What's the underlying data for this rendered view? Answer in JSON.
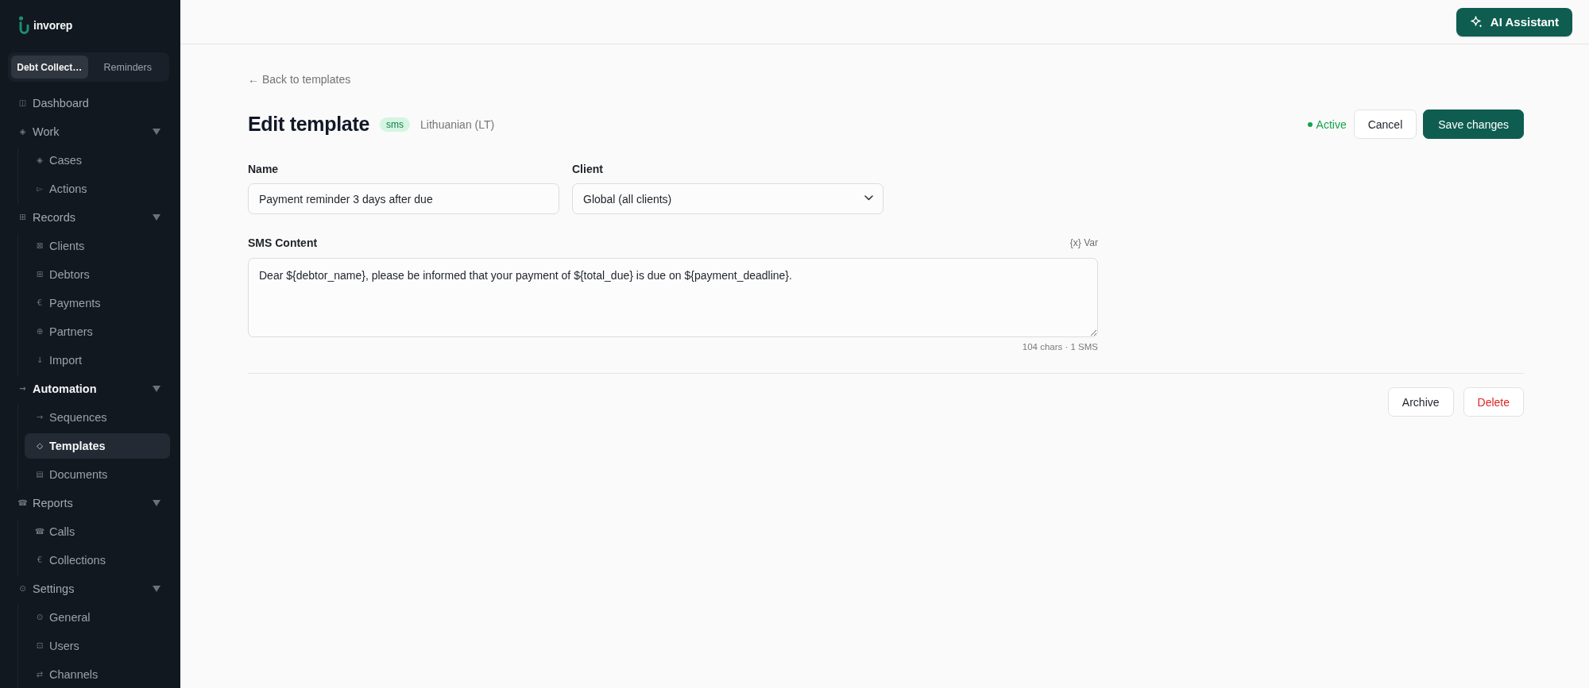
{
  "sidebar": {
    "logo": "invorep",
    "modes": [
      {
        "label": "Debt Collect…",
        "selected": true
      },
      {
        "label": "Reminders",
        "selected": false
      }
    ],
    "items": [
      {
        "icon": "◫",
        "label": "Dashboard",
        "selected": false
      },
      {
        "icon": "◈",
        "label": "Work",
        "expanded": true,
        "children": [
          {
            "icon": "◈",
            "label": "Cases",
            "selected": false
          },
          {
            "icon": "▻",
            "label": "Actions",
            "selected": false
          }
        ]
      },
      {
        "icon": "⊞",
        "label": "Records",
        "expanded": true,
        "children": [
          {
            "icon": "⊠",
            "label": "Clients",
            "selected": false
          },
          {
            "icon": "⊞",
            "label": "Debtors",
            "selected": false
          },
          {
            "icon": "€",
            "label": "Payments",
            "selected": false
          },
          {
            "icon": "⊕",
            "label": "Partners",
            "selected": false
          },
          {
            "icon": "↓",
            "label": "Import",
            "selected": false
          }
        ]
      },
      {
        "icon": "→",
        "label": "Automation",
        "expanded": true,
        "children": [
          {
            "icon": "→",
            "label": "Sequences",
            "selected": false
          },
          {
            "icon": "◇",
            "label": "Templates",
            "selected": true
          },
          {
            "icon": "▤",
            "label": "Documents",
            "selected": false
          }
        ]
      },
      {
        "icon": "☎",
        "label": "Reports",
        "expanded": true,
        "children": [
          {
            "icon": "☎",
            "label": "Calls",
            "selected": false
          },
          {
            "icon": "€",
            "label": "Collections",
            "selected": false
          }
        ]
      },
      {
        "icon": "⊙",
        "label": "Settings",
        "expanded": true,
        "children": [
          {
            "icon": "⊙",
            "label": "General",
            "selected": false
          },
          {
            "icon": "⊡",
            "label": "Users",
            "selected": false
          },
          {
            "icon": "⇄",
            "label": "Channels",
            "selected": false
          }
        ]
      }
    ]
  },
  "top_bar": {
    "assistant_button": "AI Assistant"
  },
  "editor": {
    "back_link": "← Back to templates",
    "title": "Edit template",
    "channel_badge": "sms",
    "language": "Lithuanian (LT)",
    "status": {
      "label": "Active",
      "active": true
    },
    "cancel_button": "Cancel",
    "save_button": "Save changes",
    "name_field": {
      "label": "Name",
      "value": "Payment reminder 3 days after due"
    },
    "client_field": {
      "label": "Client",
      "value": "Global (all clients)"
    },
    "content_field": {
      "label": "SMS Content",
      "variables_button": "{x} Var",
      "value": "Dear ${debtor_name}, please be informed that your payment of ${total_due} is due on ${payment_deadline}.",
      "counter": "104 chars · 1 SMS"
    },
    "archive_button": "Archive",
    "delete_button": "Delete"
  }
}
